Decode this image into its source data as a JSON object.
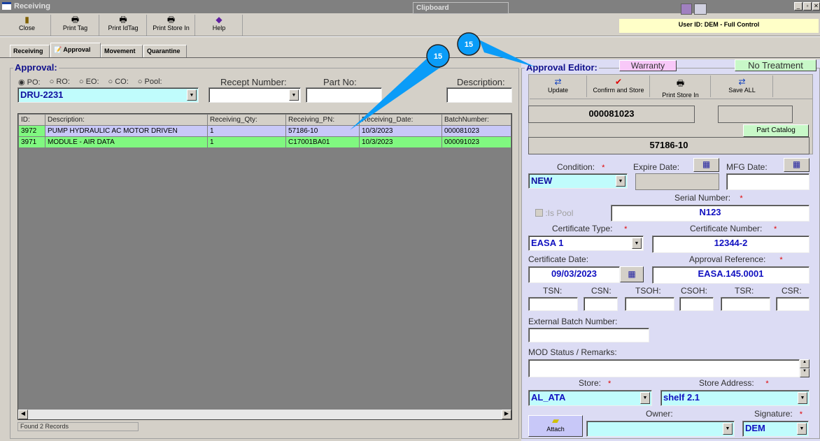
{
  "window": {
    "title": "Receiving",
    "clipboard": "Clipboard"
  },
  "toolbar": [
    {
      "label": "Close",
      "icon": "door-exit-icon"
    },
    {
      "label": "Print Tag",
      "icon": "printer-icon"
    },
    {
      "label": "Print IdTag",
      "icon": "printer-icon"
    },
    {
      "label": "Print Store In",
      "icon": "printer-icon"
    },
    {
      "label": "Help",
      "icon": "help-book-icon"
    }
  ],
  "user": "User ID: DEM - Full Control",
  "tabs": [
    "Receiving",
    "Approval",
    "Movement",
    "Quarantine"
  ],
  "approval": {
    "title": "Approval:",
    "radios": [
      "PO:",
      "RO:",
      "EO:",
      "CO:",
      "Pool:"
    ],
    "selected": "PO:",
    "po_value": "DRU-2231",
    "recept_label": "Recept Number:",
    "recept_value": "",
    "partno_label": "Part No:",
    "partno_value": "",
    "desc_label": "Description:",
    "desc_value": ""
  },
  "grid": {
    "columns": [
      "ID:",
      "Description:",
      "Receiving_Qty:",
      "Receiving_PN:",
      "Receiving_Date:",
      "BatchNumber:"
    ],
    "rows": [
      [
        "3972",
        "PUMP HYDRAULIC AC MOTOR DRIVEN",
        "1",
        "57186-10",
        "10/3/2023",
        "000081023"
      ],
      [
        "3971",
        "MODULE - AIR DATA",
        "1",
        "C17001BA01",
        "10/3/2023",
        "000091023"
      ]
    ]
  },
  "status": "Found 2 Records",
  "callouts": [
    "15",
    "15"
  ],
  "editor": {
    "title": "Approval Editor:",
    "warranty": "Warranty",
    "no_treatment": "No Treatment",
    "toolbar": [
      "Update",
      "Confirm and Store",
      "Print Store In",
      "Save ALL"
    ],
    "batch": "000081023",
    "part_catalog": "Part Catalog",
    "pn": "57186-10",
    "condition_label": "Condition:",
    "condition": "NEW",
    "expire_label": "Expire Date:",
    "mfg_label": "MFG Date:",
    "serial_label": "Serial Number:",
    "serial": "N123",
    "is_pool": "Is Pool",
    "cert_type_label": "Certificate Type:",
    "cert_type": "EASA 1",
    "cert_number_label": "Certificate Number:",
    "cert_number": "12344-2",
    "cert_date_label": "Certificate Date:",
    "cert_date": "09/03/2023",
    "approval_ref_label": "Approval Reference:",
    "approval_ref": "EASA.145.0001",
    "counters": [
      "TSN:",
      "CSN:",
      "TSOH:",
      "CSOH:",
      "TSR:",
      "CSR:"
    ],
    "ext_batch_label": "External Batch Number:",
    "mod_label": "MOD Status / Remarks:",
    "store_label": "Store:",
    "store": "AL_ATA",
    "store_addr_label": "Store Address:",
    "store_addr": "shelf 2.1",
    "attach": "Attach",
    "owner_label": "Owner:",
    "owner": "",
    "signature_label": "Signature:",
    "signature": "DEM"
  }
}
